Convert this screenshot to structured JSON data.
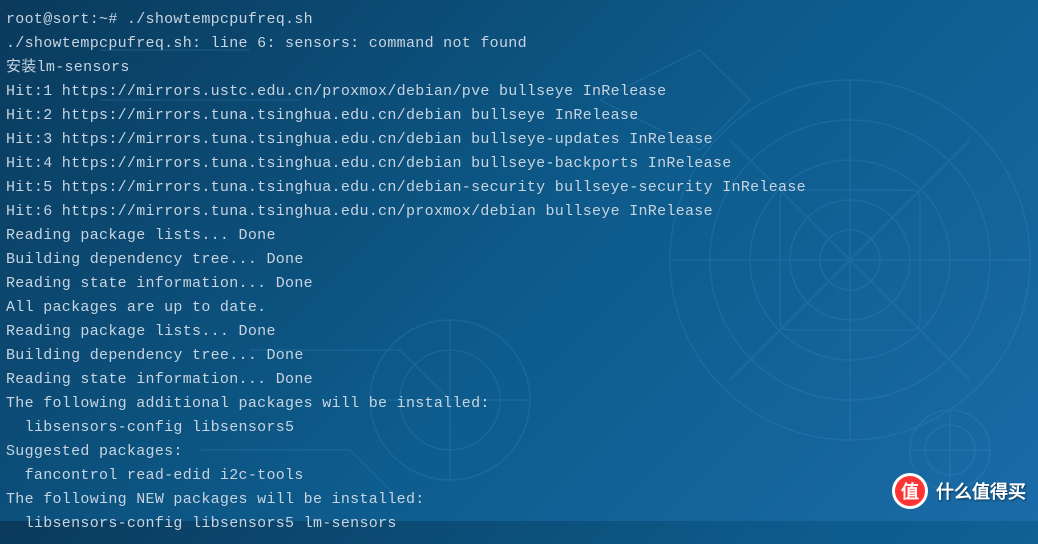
{
  "terminal": {
    "lines": [
      "root@sort:~# ./showtempcpufreq.sh",
      "./showtempcpufreq.sh: line 6: sensors: command not found",
      "安装lm-sensors",
      "Hit:1 https://mirrors.ustc.edu.cn/proxmox/debian/pve bullseye InRelease",
      "Hit:2 https://mirrors.tuna.tsinghua.edu.cn/debian bullseye InRelease",
      "Hit:3 https://mirrors.tuna.tsinghua.edu.cn/debian bullseye-updates InRelease",
      "Hit:4 https://mirrors.tuna.tsinghua.edu.cn/debian bullseye-backports InRelease",
      "Hit:5 https://mirrors.tuna.tsinghua.edu.cn/debian-security bullseye-security InRelease",
      "Hit:6 https://mirrors.tuna.tsinghua.edu.cn/proxmox/debian bullseye InRelease",
      "Reading package lists... Done",
      "Building dependency tree... Done",
      "Reading state information... Done",
      "All packages are up to date.",
      "Reading package lists... Done",
      "Building dependency tree... Done",
      "Reading state information... Done",
      "The following additional packages will be installed:",
      "  libsensors-config libsensors5",
      "Suggested packages:",
      "  fancontrol read-edid i2c-tools",
      "The following NEW packages will be installed:",
      "  libsensors-config libsensors5 lm-sensors"
    ]
  },
  "watermark": {
    "badge_text": "值",
    "label": "什么值得买"
  }
}
